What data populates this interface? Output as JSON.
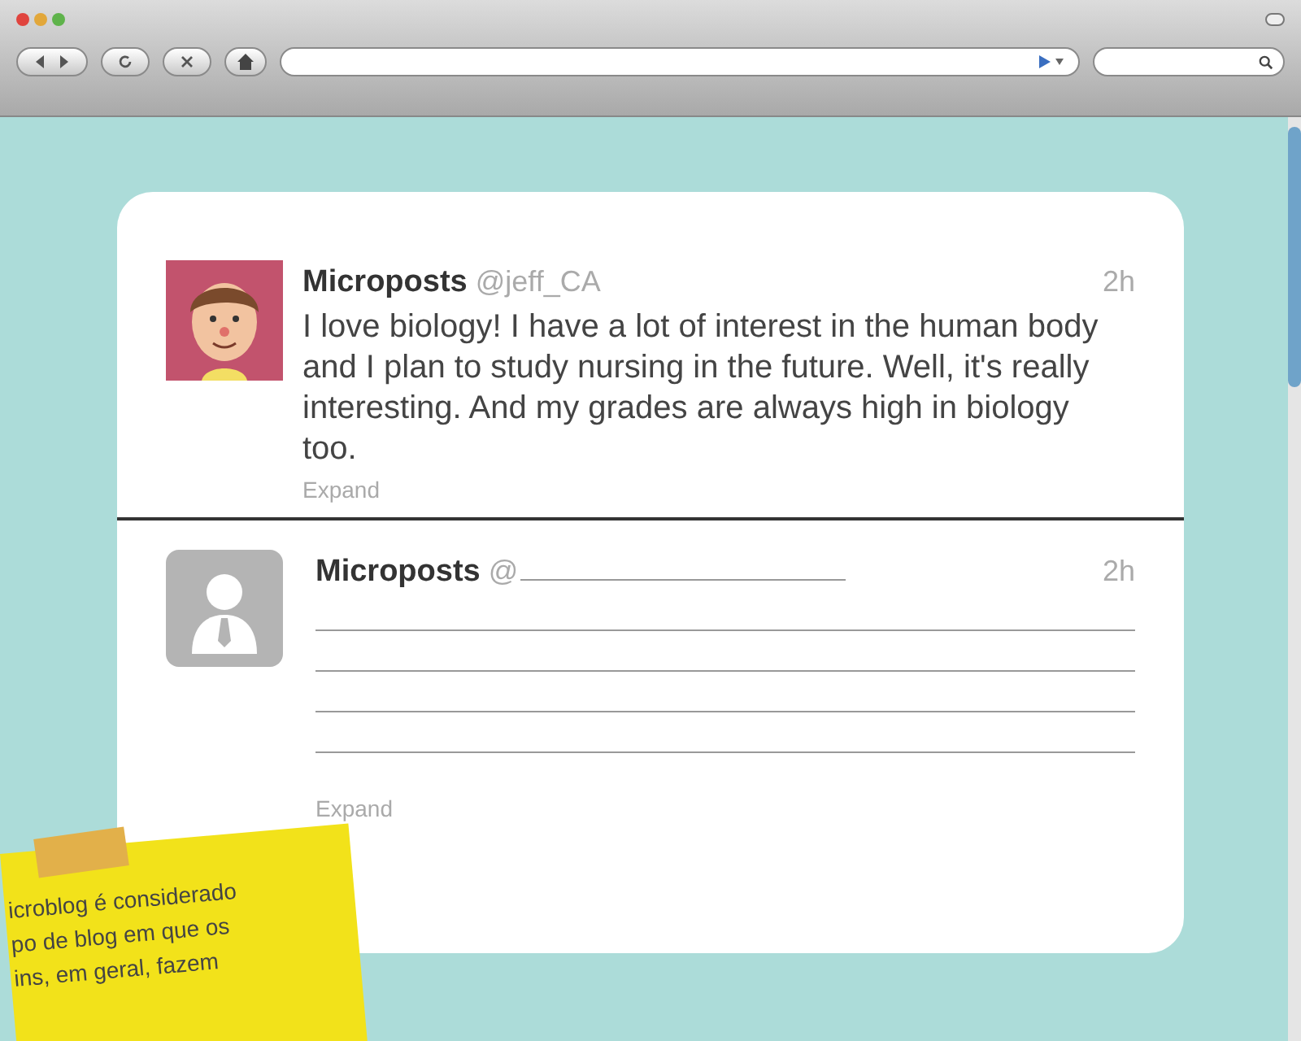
{
  "posts": [
    {
      "kind": "filled",
      "author": "Microposts",
      "handle": "@jeff_CA",
      "time": "2h",
      "text": "I love biology! I have a lot of interest in the human body and I plan to study nursing in the future. Well, it's really interesting. And my grades are always high in biology too.",
      "expand": "Expand"
    },
    {
      "kind": "blank",
      "author": "Microposts",
      "handle": "@",
      "time": "2h",
      "expand": "Expand"
    }
  ],
  "note": {
    "lines": [
      "icroblog é considerado",
      "po de blog em que os",
      "ins, em geral, fazem"
    ]
  }
}
